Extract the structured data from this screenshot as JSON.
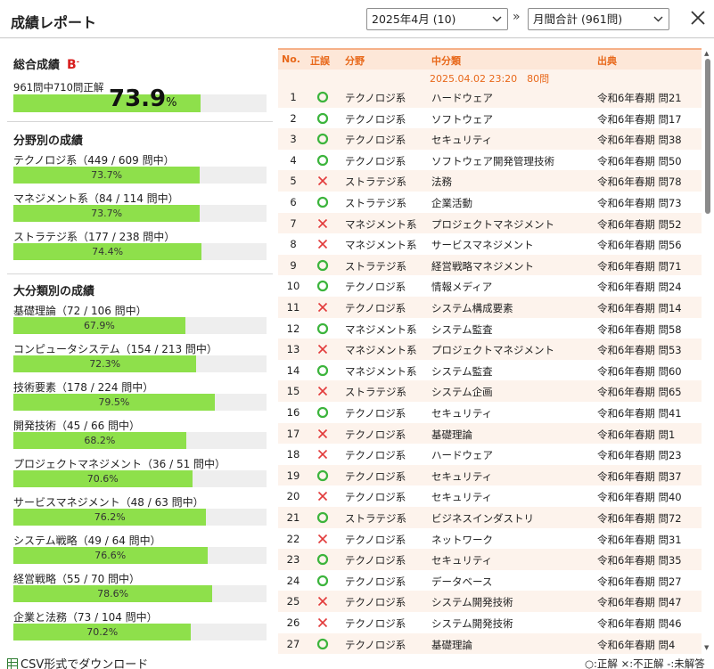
{
  "header": {
    "title": "成績レポート",
    "month_select": "2025年4月 (10)",
    "aggregate_select": "月間合計 (961問)",
    "arrows": "»"
  },
  "summary": {
    "title": "総合成績",
    "grade": "B",
    "grade_mark": "-",
    "sub": "961問中710問正解",
    "percent": "73.9",
    "unit": "%",
    "rate": 0.739
  },
  "fields": {
    "title": "分野別の成績",
    "items": [
      {
        "label": "テクノロジ系（449 / 609 問中）",
        "pct": "73.7%",
        "rate": 0.737
      },
      {
        "label": "マネジメント系（84 / 114 問中）",
        "pct": "73.7%",
        "rate": 0.737
      },
      {
        "label": "ストラテジ系（177 / 238 問中）",
        "pct": "74.4%",
        "rate": 0.744
      }
    ]
  },
  "categories": {
    "title": "大分類別の成績",
    "items": [
      {
        "label": "基礎理論（72 / 106 問中）",
        "pct": "67.9%",
        "rate": 0.679
      },
      {
        "label": "コンピュータシステム（154 / 213 問中）",
        "pct": "72.3%",
        "rate": 0.723
      },
      {
        "label": "技術要素（178 / 224 問中）",
        "pct": "79.5%",
        "rate": 0.795
      },
      {
        "label": "開発技術（45 / 66 問中）",
        "pct": "68.2%",
        "rate": 0.682
      },
      {
        "label": "プロジェクトマネジメント（36 / 51 問中）",
        "pct": "70.6%",
        "rate": 0.706
      },
      {
        "label": "サービスマネジメント（48 / 63 問中）",
        "pct": "76.2%",
        "rate": 0.762
      },
      {
        "label": "システム戦略（49 / 64 問中）",
        "pct": "76.6%",
        "rate": 0.766
      },
      {
        "label": "経営戦略（55 / 70 問中）",
        "pct": "78.6%",
        "rate": 0.786
      },
      {
        "label": "企業と法務（73 / 104 問中）",
        "pct": "70.2%",
        "rate": 0.702
      }
    ]
  },
  "table": {
    "headers": {
      "no": "No.",
      "mark": "正誤",
      "field": "分野",
      "sub": "中分類",
      "src": "出典"
    },
    "session": "2025.04.02 23:20　80問",
    "rows": [
      {
        "no": "1",
        "ok": true,
        "field": "テクノロジ系",
        "sub": "ハードウェア",
        "src": "令和6年春期 問21"
      },
      {
        "no": "2",
        "ok": true,
        "field": "テクノロジ系",
        "sub": "ソフトウェア",
        "src": "令和6年春期 問17"
      },
      {
        "no": "3",
        "ok": true,
        "field": "テクノロジ系",
        "sub": "セキュリティ",
        "src": "令和6年春期 問38"
      },
      {
        "no": "4",
        "ok": true,
        "field": "テクノロジ系",
        "sub": "ソフトウェア開発管理技術",
        "src": "令和6年春期 問50"
      },
      {
        "no": "5",
        "ok": false,
        "field": "ストラテジ系",
        "sub": "法務",
        "src": "令和6年春期 問78"
      },
      {
        "no": "6",
        "ok": true,
        "field": "ストラテジ系",
        "sub": "企業活動",
        "src": "令和6年春期 問73"
      },
      {
        "no": "7",
        "ok": false,
        "field": "マネジメント系",
        "sub": "プロジェクトマネジメント",
        "src": "令和6年春期 問52"
      },
      {
        "no": "8",
        "ok": false,
        "field": "マネジメント系",
        "sub": "サービスマネジメント",
        "src": "令和6年春期 問56"
      },
      {
        "no": "9",
        "ok": true,
        "field": "ストラテジ系",
        "sub": "経営戦略マネジメント",
        "src": "令和6年春期 問71"
      },
      {
        "no": "10",
        "ok": true,
        "field": "テクノロジ系",
        "sub": "情報メディア",
        "src": "令和6年春期 問24"
      },
      {
        "no": "11",
        "ok": false,
        "field": "テクノロジ系",
        "sub": "システム構成要素",
        "src": "令和6年春期 問14"
      },
      {
        "no": "12",
        "ok": true,
        "field": "マネジメント系",
        "sub": "システム監査",
        "src": "令和6年春期 問58"
      },
      {
        "no": "13",
        "ok": false,
        "field": "マネジメント系",
        "sub": "プロジェクトマネジメント",
        "src": "令和6年春期 問53"
      },
      {
        "no": "14",
        "ok": true,
        "field": "マネジメント系",
        "sub": "システム監査",
        "src": "令和6年春期 問60"
      },
      {
        "no": "15",
        "ok": false,
        "field": "ストラテジ系",
        "sub": "システム企画",
        "src": "令和6年春期 問65"
      },
      {
        "no": "16",
        "ok": true,
        "field": "テクノロジ系",
        "sub": "セキュリティ",
        "src": "令和6年春期 問41"
      },
      {
        "no": "17",
        "ok": false,
        "field": "テクノロジ系",
        "sub": "基礎理論",
        "src": "令和6年春期 問1"
      },
      {
        "no": "18",
        "ok": false,
        "field": "テクノロジ系",
        "sub": "ハードウェア",
        "src": "令和6年春期 問23"
      },
      {
        "no": "19",
        "ok": true,
        "field": "テクノロジ系",
        "sub": "セキュリティ",
        "src": "令和6年春期 問37"
      },
      {
        "no": "20",
        "ok": false,
        "field": "テクノロジ系",
        "sub": "セキュリティ",
        "src": "令和6年春期 問40"
      },
      {
        "no": "21",
        "ok": true,
        "field": "ストラテジ系",
        "sub": "ビジネスインダストリ",
        "src": "令和6年春期 問72"
      },
      {
        "no": "22",
        "ok": false,
        "field": "テクノロジ系",
        "sub": "ネットワーク",
        "src": "令和6年春期 問31"
      },
      {
        "no": "23",
        "ok": true,
        "field": "テクノロジ系",
        "sub": "セキュリティ",
        "src": "令和6年春期 問35"
      },
      {
        "no": "24",
        "ok": true,
        "field": "テクノロジ系",
        "sub": "データベース",
        "src": "令和6年春期 問27"
      },
      {
        "no": "25",
        "ok": false,
        "field": "テクノロジ系",
        "sub": "システム開発技術",
        "src": "令和6年春期 問47"
      },
      {
        "no": "26",
        "ok": false,
        "field": "テクノロジ系",
        "sub": "システム開発技術",
        "src": "令和6年春期 問46"
      },
      {
        "no": "27",
        "ok": true,
        "field": "テクノロジ系",
        "sub": "基礎理論",
        "src": "令和6年春期 問4"
      }
    ]
  },
  "footer": {
    "csv": "CSV形式でダウンロード",
    "legend": "○:正解 ×:不正解 -:未解答"
  },
  "colors": {
    "bar_fill": "#8ee04b",
    "correct": "#3cb43c",
    "wrong": "#e23b3b",
    "accent": "#e8681a"
  }
}
